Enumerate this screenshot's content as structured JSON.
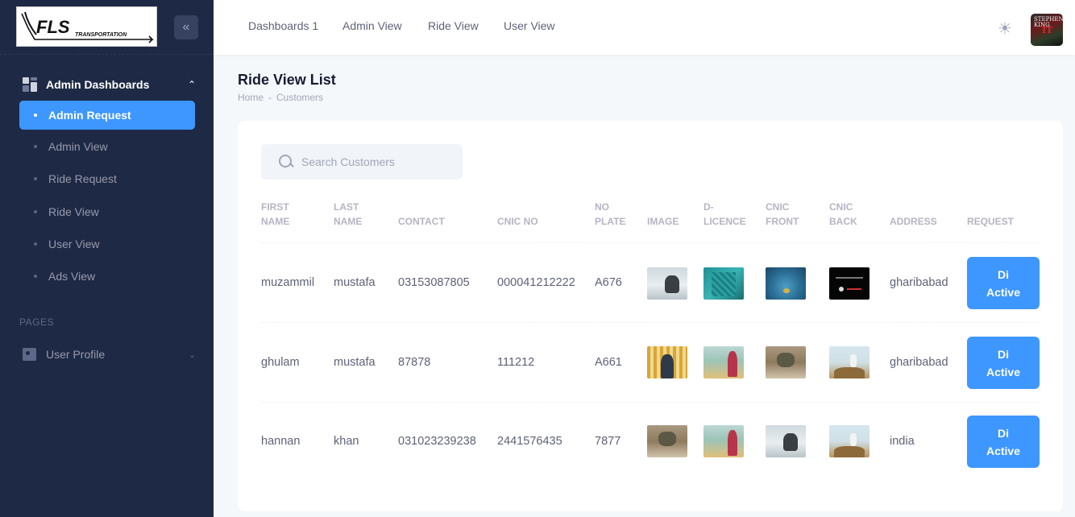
{
  "app": {
    "logo_text": "FLS",
    "logo_subtext": "TRANSPORTATION",
    "collapse_icon": "double-chevron-left-icon"
  },
  "sidebar": {
    "section_label": "Admin Dashboards",
    "items": [
      {
        "label": "Admin Request",
        "active": true
      },
      {
        "label": "Admin View",
        "active": false
      },
      {
        "label": "Ride Request",
        "active": false
      },
      {
        "label": "Ride View",
        "active": false
      },
      {
        "label": "User View",
        "active": false
      },
      {
        "label": "Ads View",
        "active": false
      }
    ],
    "pages_heading": "PAGES",
    "profile_label": "User Profile"
  },
  "header": {
    "nav": [
      "Dashboards 1",
      "Admin View",
      "Ride View",
      "User View"
    ],
    "theme_icon": "sun-icon",
    "avatar_text_top": "STEPHEN KING",
    "avatar_text_mid": "IT"
  },
  "page": {
    "title": "Ride View List",
    "breadcrumb": [
      "Home",
      "-",
      "Customers"
    ]
  },
  "search": {
    "placeholder": "Search Customers",
    "value": ""
  },
  "table": {
    "columns": [
      "FIRST\nNAME",
      "LAST\nNAME",
      "CONTACT",
      "CNIC NO",
      "NO\nPLATE",
      "IMAGE",
      "D-\nLICENCE",
      "CNIC\nFRONT",
      "CNIC\nBACK",
      "ADDRESS",
      "REQUEST"
    ],
    "button_label": "Di\nActive",
    "rows": [
      {
        "first": "muzammil",
        "last": "mustafa",
        "contact": "03153087805",
        "cnic": "000041212222",
        "plate": "A676",
        "address": "gharibabad"
      },
      {
        "first": "ghulam",
        "last": "mustafa",
        "contact": "87878",
        "cnic": "111212",
        "plate": "A661",
        "address": "gharibabad"
      },
      {
        "first": "hannan",
        "last": "khan",
        "contact": "031023239238",
        "cnic": "2441576435",
        "plate": "7877",
        "address": "india"
      }
    ]
  },
  "colors": {
    "sidebar_bg": "#1e2a45",
    "accent": "#3e97ff",
    "page_bg": "#f5f8fa"
  }
}
